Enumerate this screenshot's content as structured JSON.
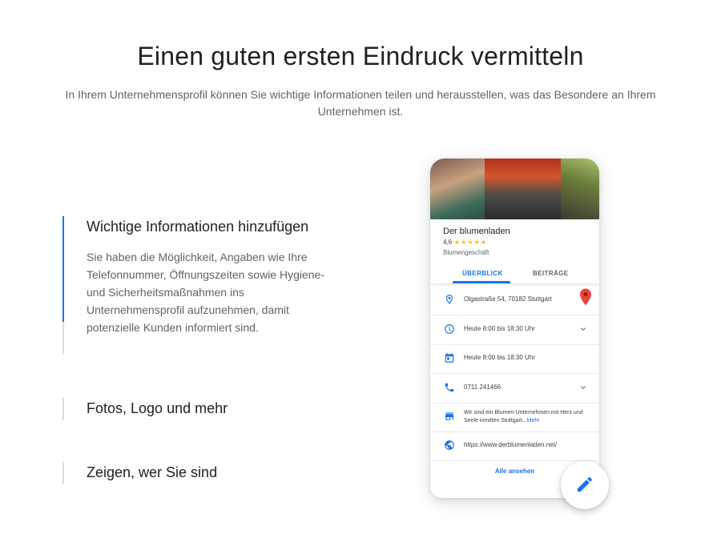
{
  "headline": "Einen guten ersten Eindruck vermitteln",
  "subline": "In Ihrem Unternehmensprofil können Sie wichtige Informationen teilen und herausstellen, was das Besondere an Ihrem Unternehmen ist.",
  "accordion": [
    {
      "title": "Wichtige Informationen hinzufügen",
      "body": "Sie haben die Möglichkeit, Angaben wie Ihre Telefonnummer, Öffnungszeiten sowie Hygiene- und Sicherheitsmaßnahmen ins Unternehmensprofil aufzunehmen, damit potenzielle Kunden informiert sind.",
      "progress": 0.77
    },
    {
      "title": "Fotos, Logo und mehr"
    },
    {
      "title": "Zeigen, wer Sie sind"
    }
  ],
  "profile": {
    "name": "Der blumenladen",
    "rating": "4,6",
    "stars": "★★★★★",
    "category": "Blumengeschäft",
    "tabs": [
      "ÜBERBLICK",
      "BEITRÄGE"
    ],
    "address": "Olgastraße 54, 70182 Stuttgart",
    "hours1": "Heute 8:00 bis 18:30 Uhr",
    "hours2": "Heute 8:00 bis 18:30 Uhr",
    "phone": "0711 241466",
    "description": "Wir sind ein Blumen-Unternehmen mit Herz und Seele inmitten Stuttgart...",
    "description_more": "Mehr",
    "website": "https://www.derblumenladen.net/",
    "see_all": "Alle ansehen"
  },
  "colors": {
    "accent": "#1a73e8",
    "star": "#fbbc04",
    "pin": "#ea4335",
    "text": "#202124",
    "muted": "#5f6368"
  },
  "icons": [
    "location-icon",
    "clock-icon",
    "calendar-icon",
    "phone-icon",
    "storefront-icon",
    "globe-icon",
    "chevron-down-icon",
    "map-pin-icon",
    "edit-pencil-icon"
  ]
}
